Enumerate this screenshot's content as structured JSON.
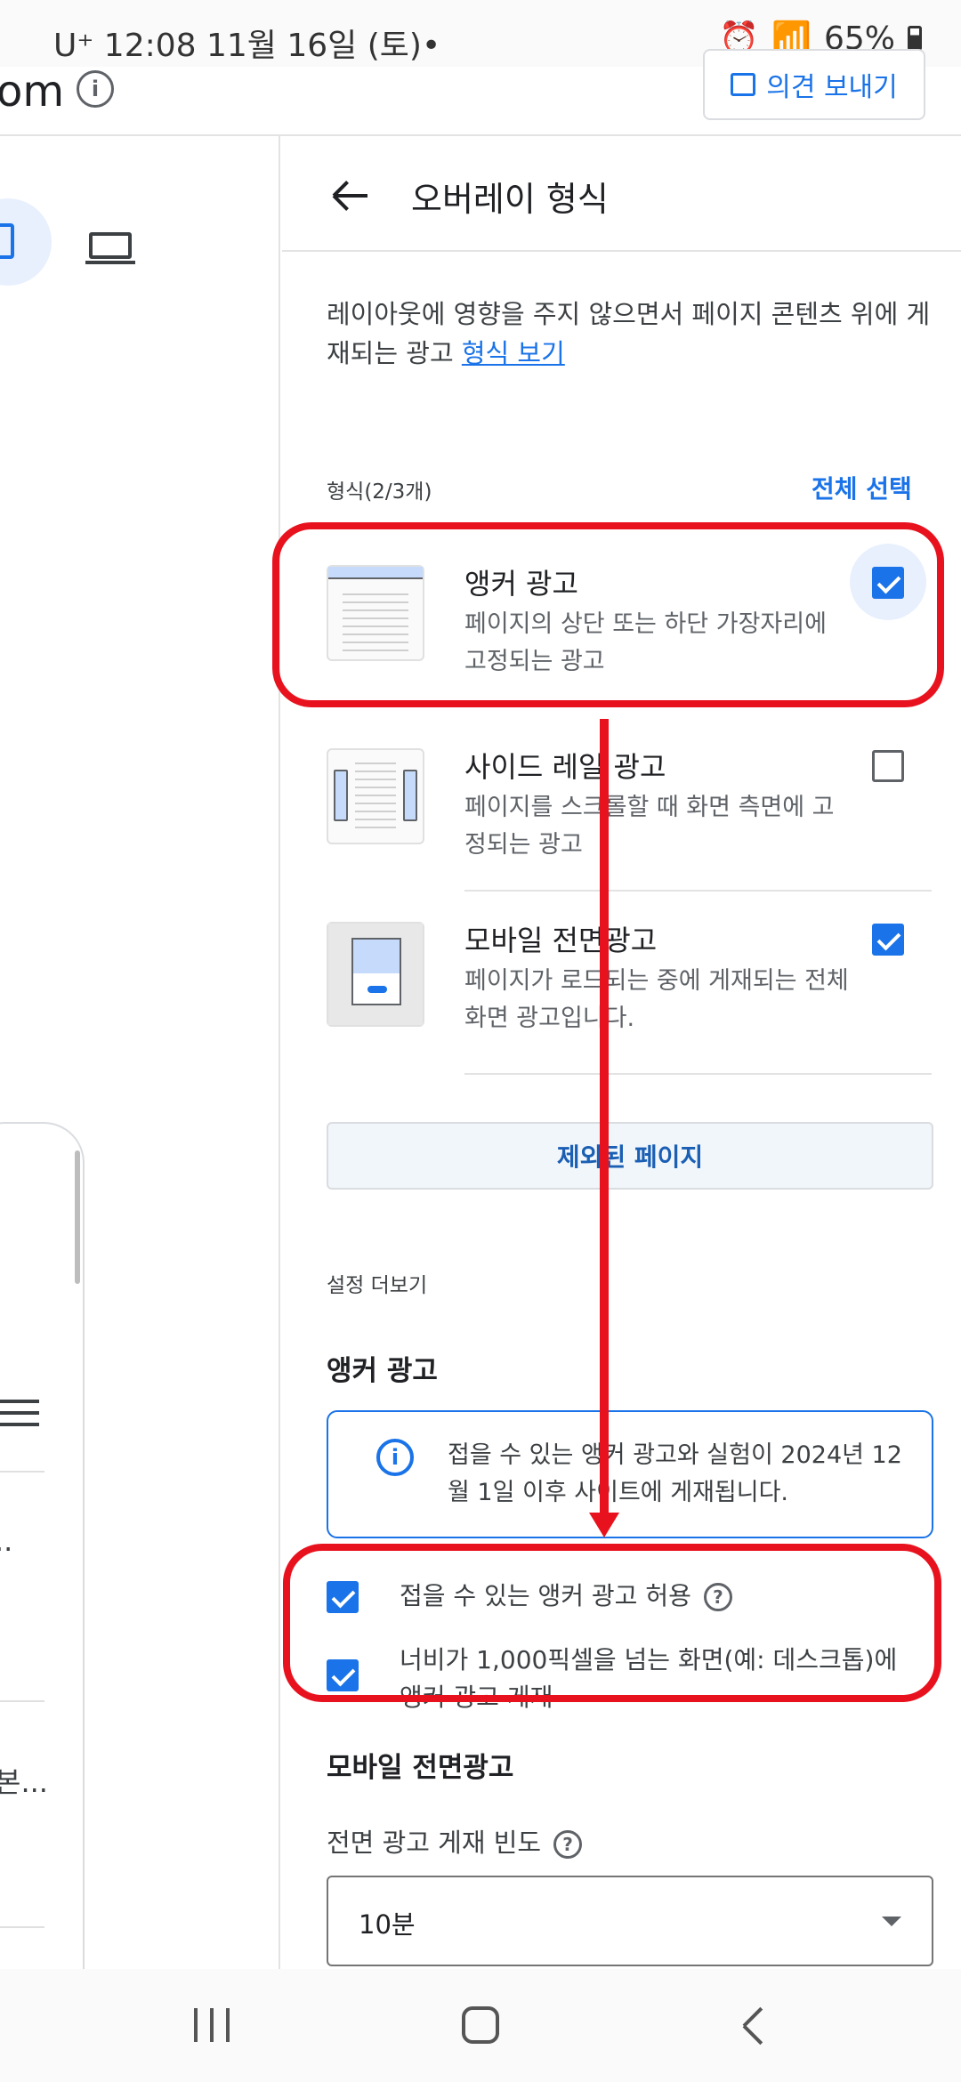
{
  "status_bar": {
    "carrier_time_date": "U⁺ 12:08   11월 16일 (토)•",
    "battery": "65%"
  },
  "top_strip": {
    "domain_fragment": "om",
    "info_glyph": "i",
    "feedback_label": "의견 보내기"
  },
  "left_pane": {
    "row_text_1": "..",
    "row_text_2": "본..."
  },
  "panel": {
    "title": "오버레이 형식",
    "description": "레이아웃에 영향을 주지 않으면서 페이지 콘텐츠 위에 게재되는 광고",
    "description_link": "형식 보기",
    "formats_label": "형식(2/3개)",
    "select_all": "전체 선택",
    "formats": [
      {
        "title": "앵커 광고",
        "desc": "페이지의 상단 또는 하단 가장자리에 고정되는 광고",
        "checked": true
      },
      {
        "title": "사이드 레일 광고",
        "desc": "페이지를 스크롤할 때 화면 측면에 고정되는 광고",
        "checked": false
      },
      {
        "title": "모바일 전면광고",
        "desc": "페이지가 로드되는 중에 게재되는 전체 화면 광고입니다.",
        "checked": true
      }
    ],
    "excluded_pages": "제외된 페이지",
    "more_settings": "설정 더보기",
    "anchor_section": {
      "heading": "앵커 광고",
      "info": "접을 수 있는 앵커 광고와 실험이 2024년 12월 1일 이후 사이트에 게재됩니다.",
      "options": [
        {
          "label": "접을 수 있는 앵커 광고 허용",
          "checked": true
        },
        {
          "label": "너비가 1,000픽셀을 넘는 화면(예: 데스크톱)에 앵커 광고 게재",
          "checked": true
        }
      ]
    },
    "vignette_section": {
      "heading": "모바일 전면광고",
      "freq_label": "전면 광고 게재 빈도",
      "freq_value": "10분"
    }
  },
  "colors": {
    "accent": "#1a73e8",
    "annotation": "#e8121e"
  },
  "icons": [
    "info-icon",
    "feedback-icon",
    "tablet-icon",
    "laptop-icon",
    "menu-icon",
    "back-arrow-icon",
    "help-icon",
    "dropdown-caret-icon",
    "nav-recents-icon",
    "nav-home-icon",
    "nav-back-icon"
  ]
}
